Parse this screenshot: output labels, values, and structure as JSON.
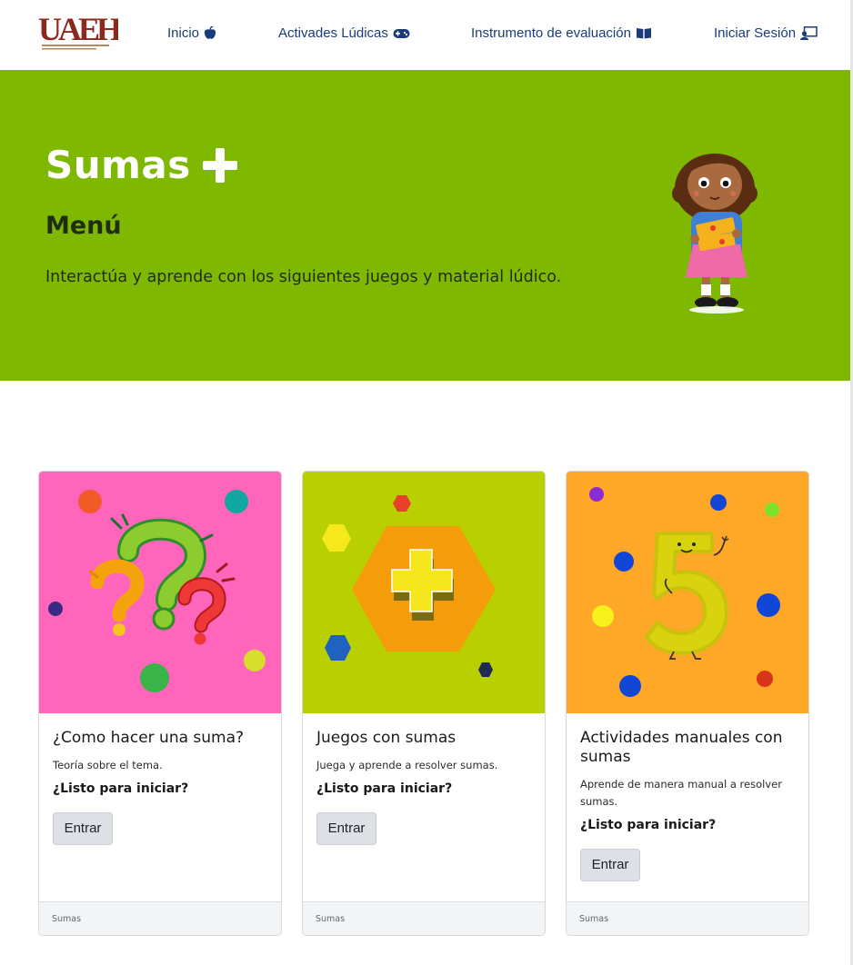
{
  "nav": {
    "logo_text": "UAEH",
    "items": [
      {
        "label": "Inicio",
        "icon": "apple-icon"
      },
      {
        "label": "Activades Lúdicas",
        "icon": "gamepad-icon"
      },
      {
        "label": "Instrumento de evaluación",
        "icon": "book-icon"
      },
      {
        "label": "Iniciar Sesión",
        "icon": "user-screen-icon"
      }
    ]
  },
  "hero": {
    "title": "Sumas",
    "subtitle": "Menú",
    "description": "Interactúa y aprende con los siguientes juegos y material lúdico.",
    "background": "#7fb800"
  },
  "cards": [
    {
      "title": "¿Como hacer una suma?",
      "text": "Teoría sobre el tema.",
      "ready": "¿Listo para iniciar?",
      "button": "Entrar",
      "footer": "Sumas",
      "image_bg": "#ff66bb"
    },
    {
      "title": "Juegos con sumas",
      "text": "Juega y aprende a resolver sumas.",
      "ready": "¿Listo para iniciar?",
      "button": "Entrar",
      "footer": "Sumas",
      "image_bg": "#b9d000"
    },
    {
      "title": "Actividades manuales con sumas",
      "text": "Aprende de manera manual a resolver sumas.",
      "ready": "¿Listo para iniciar?",
      "button": "Entrar",
      "footer": "Sumas",
      "image_bg": "#ffa726"
    }
  ]
}
